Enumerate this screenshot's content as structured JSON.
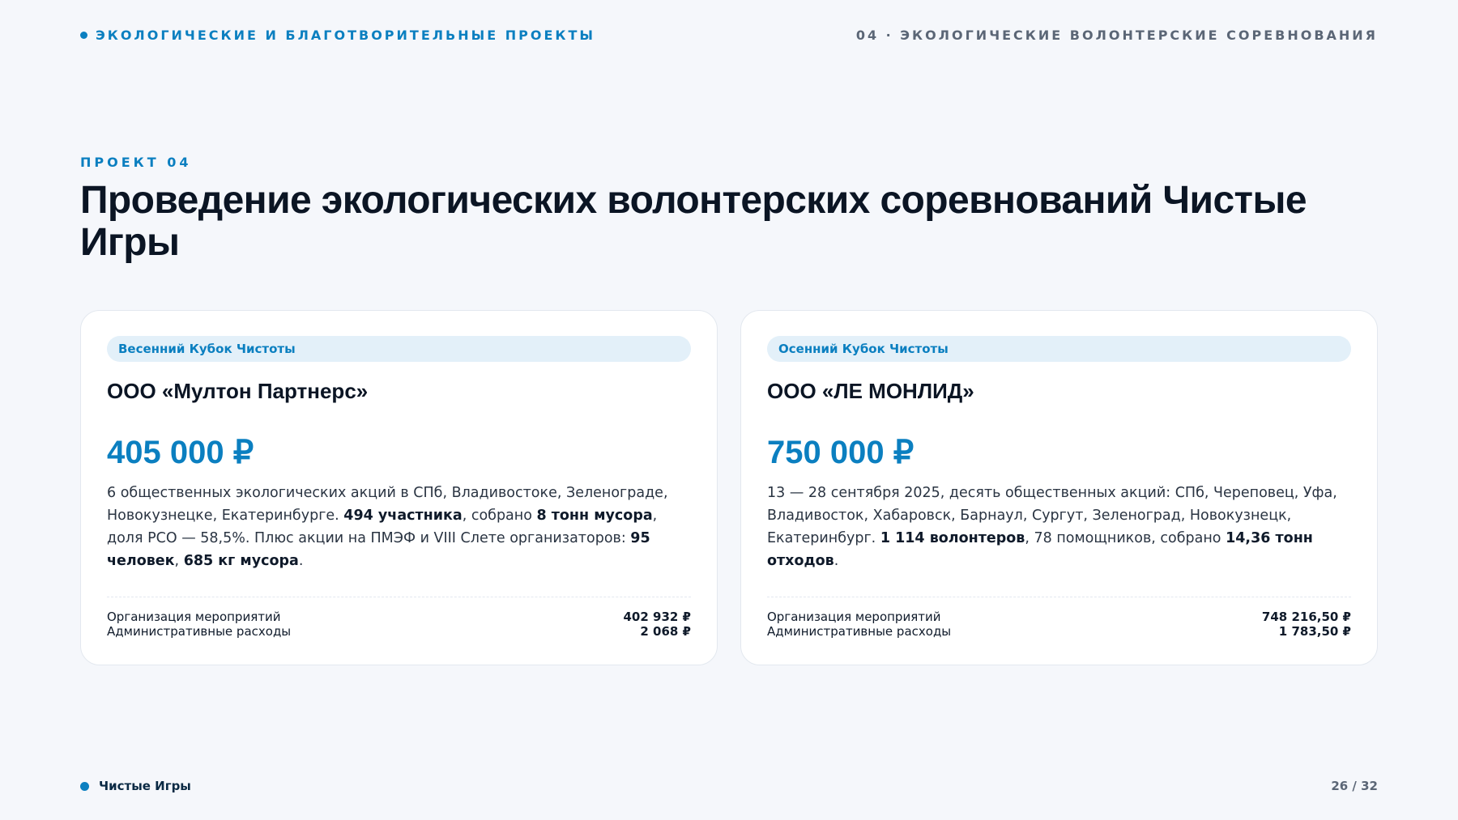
{
  "header": {
    "section": "ЭКОЛОГИЧЕСКИЕ И БЛАГОТВОРИТЕЛЬНЫЕ ПРОЕКТЫ",
    "chapter": "04 · ЭКОЛОГИЧЕСКИЕ ВОЛОНТЕРСКИЕ СОРЕВНОВАНИЯ"
  },
  "project": {
    "eyebrow": "ПРОЕКТ 04",
    "title": "Проведение экологических волонтерских соревнований Чистые Игры"
  },
  "cards": [
    {
      "badge": "Весенний Кубок Чистоты",
      "company": "ООО «Мултон Партнерс»",
      "amount": "405 000 ₽",
      "desc": [
        {
          "t": "6 общественных экологических акций в СПб, Владивостоке, Зеленограде, Новокузнецке, Екатеринбурге. "
        },
        {
          "t": "494 участника",
          "b": true
        },
        {
          "t": ", собрано "
        },
        {
          "t": "8 тонн мусора",
          "b": true
        },
        {
          "t": ", доля РСО — 58,5%. Плюс акции на ПМЭФ и VIII Слете организаторов: "
        },
        {
          "t": "95 человек",
          "b": true
        },
        {
          "t": ", "
        },
        {
          "t": "685 кг мусора",
          "b": true
        },
        {
          "t": "."
        }
      ],
      "breakdown": [
        {
          "label": "Организация мероприятий",
          "value": "402 932 ₽"
        },
        {
          "label": "Административные расходы",
          "value": "2 068 ₽"
        }
      ]
    },
    {
      "badge": "Осенний Кубок Чистоты",
      "company": "ООО «ЛЕ МОНЛИД»",
      "amount": "750 000 ₽",
      "desc": [
        {
          "t": "13 — 28 сентября 2025, десять общественных акций: СПб, Череповец, Уфа, Владивосток, Хабаровск, Барнаул, Сургут, Зеленоград, Новокузнецк, Екатеринбург. "
        },
        {
          "t": "1 114 волонтеров",
          "b": true
        },
        {
          "t": ", 78 помощников, собрано "
        },
        {
          "t": "14,36 тонн отходов",
          "b": true
        },
        {
          "t": "."
        }
      ],
      "breakdown": [
        {
          "label": "Организация мероприятий",
          "value": "748 216,50 ₽"
        },
        {
          "label": "Административные расходы",
          "value": "1 783,50 ₽"
        }
      ]
    }
  ],
  "footer": {
    "brand": "Чистые Игры",
    "page": "26 / 32"
  },
  "colors": {
    "accent": "#0b7fc0",
    "background": "#f5f7fb",
    "badge_bg": "#e3f0f9",
    "muted": "#5b6676"
  }
}
